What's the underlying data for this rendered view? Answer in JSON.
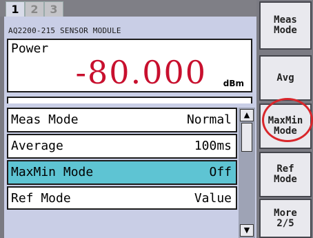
{
  "tabs": [
    "1",
    "2",
    "3"
  ],
  "module": {
    "title": "AQ2200-215 SENSOR MODULE"
  },
  "power": {
    "label": "Power",
    "value": "-80.000",
    "unit": "dBm"
  },
  "settings": [
    {
      "label": "Meas Mode",
      "value": "Normal"
    },
    {
      "label": "Average",
      "value": "100ms"
    },
    {
      "label": "MaxMin Mode",
      "value": "Off"
    },
    {
      "label": "Ref Mode",
      "value": "Value"
    }
  ],
  "selected_row": "MaxMin Mode",
  "scrollbar": {
    "up_icon": "triangle-up",
    "down_icon": "triangle-down"
  },
  "softkeys": [
    {
      "line1": "Meas",
      "line2": "Mode"
    },
    {
      "line1": "Avg",
      "line2": ""
    },
    {
      "line1": "MaxMin",
      "line2": "Mode"
    },
    {
      "line1": "Ref",
      "line2": "Mode"
    },
    {
      "line1": "More",
      "line2": "2/5"
    }
  ],
  "colors": {
    "panel": "#c9cee6",
    "selected_row": "#5ec4d3",
    "power_value": "#c8102e",
    "highlight_circle": "#d9262b"
  }
}
